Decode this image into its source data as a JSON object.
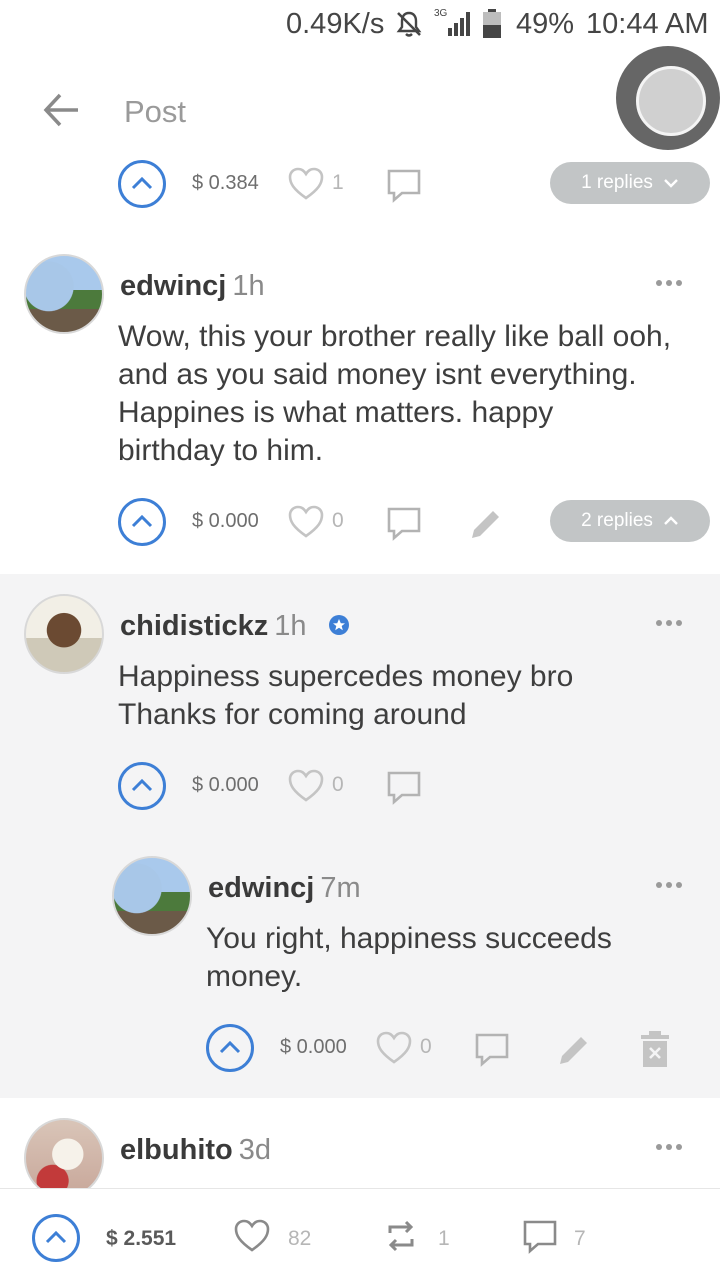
{
  "status_bar": {
    "speed": "0.49K/s",
    "network": "3G",
    "battery_pct": "49%",
    "time": "10:44 AM"
  },
  "header": {
    "title": "Post",
    "back_icon": "arrow-left-icon"
  },
  "top_partial_comment": {
    "payout": "$ 0.384",
    "likes": "1",
    "replies_label": "1 replies"
  },
  "comments": [
    {
      "author": "edwincj",
      "ago": "1h",
      "lines": [
        "Wow, this your brother really like ball ooh,",
        "and as you said money isnt everything.",
        "Happines is what matters. happy",
        "birthday to him."
      ],
      "payout": "$ 0.000",
      "likes": "0",
      "replies_label": "2 replies"
    },
    {
      "author": "chidistickz",
      "ago": "1h",
      "verified": true,
      "lines": [
        "Happiness supercedes money bro",
        "Thanks for coming around"
      ],
      "payout": "$ 0.000",
      "likes": "0"
    },
    {
      "author": "edwincj",
      "ago": "7m",
      "lines": [
        "You right, happiness succeeds",
        "money."
      ],
      "payout": "$ 0.000",
      "likes": "0"
    },
    {
      "author": "elbuhito",
      "ago": "3d"
    }
  ],
  "bottom_bar": {
    "payout": "$ 2.551",
    "likes": "82",
    "resteems": "1",
    "comments": "7"
  },
  "colors": {
    "accent_blue": "#3d7fd6",
    "pill_grey": "#c2c5c6",
    "thread_bg": "#f4f4f5"
  }
}
